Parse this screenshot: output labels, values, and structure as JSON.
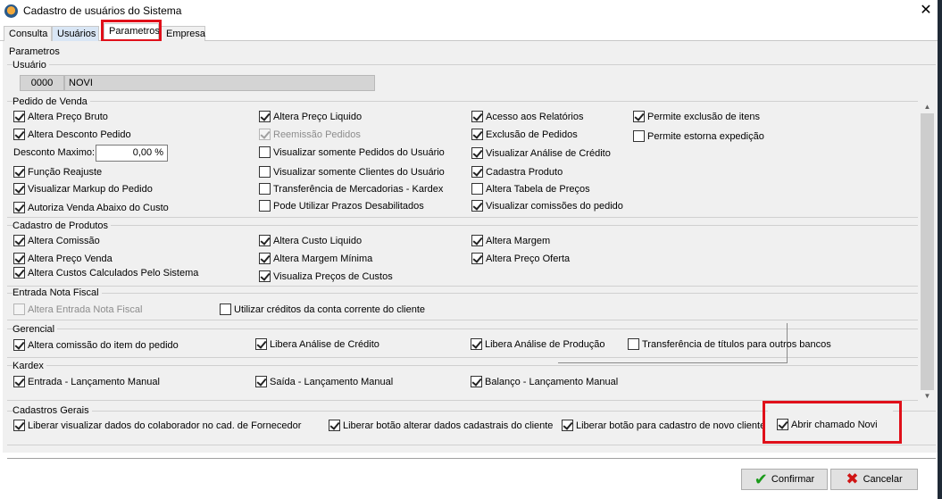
{
  "window": {
    "title": "Cadastro de usuários do Sistema",
    "close_icon": "close-icon"
  },
  "tabs": [
    "Consulta",
    "Usuários",
    "Parametros",
    "Empresa"
  ],
  "panel_title": "Parametros",
  "usuario": {
    "label": "Usuário",
    "code": "0000",
    "name": "NOVI"
  },
  "pedido_venda": {
    "title": "Pedido de Venda",
    "desconto_label": "Desconto Maximo:",
    "desconto_value": "0,00 %",
    "items": [
      {
        "label": "Altera Preço Bruto",
        "checked": true,
        "disabled": false
      },
      {
        "label": "Altera Desconto Pedido",
        "checked": true,
        "disabled": false
      },
      {
        "label": "Função Reajuste",
        "checked": true,
        "disabled": false
      },
      {
        "label": "Visualizar Markup do Pedido",
        "checked": true,
        "disabled": false
      },
      {
        "label": "Autoriza Venda Abaixo do Custo",
        "checked": true,
        "disabled": false
      },
      {
        "label": "Altera Preço Liquido",
        "checked": true,
        "disabled": false
      },
      {
        "label": "Reemissão Pedidos",
        "checked": true,
        "disabled": true
      },
      {
        "label": "Visualizar somente Pedidos do Usuário",
        "checked": false,
        "disabled": false
      },
      {
        "label": "Visualizar somente Clientes do Usuário",
        "checked": false,
        "disabled": false
      },
      {
        "label": "Transferência de Mercadorias - Kardex",
        "checked": false,
        "disabled": false
      },
      {
        "label": "Pode Utilizar Prazos Desabilitados",
        "checked": false,
        "disabled": false
      },
      {
        "label": "Acesso aos Relatórios",
        "checked": true,
        "disabled": false
      },
      {
        "label": "Exclusão de Pedidos",
        "checked": true,
        "disabled": false
      },
      {
        "label": "Visualizar Análise de Crédito",
        "checked": true,
        "disabled": false
      },
      {
        "label": "Cadastra Produto",
        "checked": true,
        "disabled": false
      },
      {
        "label": "Altera Tabela de Preços",
        "checked": false,
        "disabled": false
      },
      {
        "label": "Visualizar comissões do pedido",
        "checked": true,
        "disabled": false
      },
      {
        "label": "Permite exclusão de itens",
        "checked": true,
        "disabled": false
      },
      {
        "label": "Permite estorna expedição",
        "checked": false,
        "disabled": false
      }
    ]
  },
  "cadastro_produtos": {
    "title": "Cadastro de Produtos",
    "items": [
      {
        "label": "Altera Comissão",
        "checked": true,
        "disabled": false
      },
      {
        "label": "Altera Preço Venda",
        "checked": true,
        "disabled": false
      },
      {
        "label": "Altera Custos Calculados Pelo Sistema",
        "checked": true,
        "disabled": false
      },
      {
        "label": "Altera Custo Liquido",
        "checked": true,
        "disabled": false
      },
      {
        "label": "Altera Margem Mínima",
        "checked": true,
        "disabled": false
      },
      {
        "label": "Visualiza Preços de Custos",
        "checked": true,
        "disabled": false
      },
      {
        "label": "Altera Margem",
        "checked": true,
        "disabled": false
      },
      {
        "label": "Altera Preço Oferta",
        "checked": true,
        "disabled": false
      }
    ]
  },
  "entrada_nf": {
    "title": "Entrada Nota Fiscal",
    "items": [
      {
        "label": "Altera Entrada Nota Fiscal",
        "checked": false,
        "disabled": true
      },
      {
        "label": "Utilizar créditos da conta corrente do cliente",
        "checked": false,
        "disabled": false
      }
    ]
  },
  "gerencial": {
    "title": "Gerencial",
    "items": [
      {
        "label": "Altera comissão do item do pedido",
        "checked": true,
        "disabled": false
      },
      {
        "label": "Libera Análise de Crédito",
        "checked": true,
        "disabled": false
      },
      {
        "label": "Libera Análise de Produção",
        "checked": true,
        "disabled": false
      },
      {
        "label": "Transferência de títulos para outros bancos",
        "checked": false,
        "disabled": false
      }
    ]
  },
  "kardex": {
    "title": "Kardex",
    "items": [
      {
        "label": "Entrada - Lançamento Manual",
        "checked": true,
        "disabled": false
      },
      {
        "label": "Saída - Lançamento Manual",
        "checked": true,
        "disabled": false
      },
      {
        "label": "Balanço - Lançamento Manual",
        "checked": true,
        "disabled": false
      }
    ]
  },
  "cadastros_gerais": {
    "title": "Cadastros Gerais",
    "items": [
      {
        "label": "Liberar visualizar dados do colaborador no cad. de Fornecedor",
        "checked": true,
        "disabled": false
      },
      {
        "label": "Liberar botão alterar dados cadastrais do cliente",
        "checked": true,
        "disabled": false
      },
      {
        "label": "Liberar botão para cadastro de novo cliente",
        "checked": true,
        "disabled": false
      },
      {
        "label": "Abrir chamado Novi",
        "checked": true,
        "disabled": false
      }
    ]
  },
  "buttons": {
    "confirm": "Confirmar",
    "cancel": "Cancelar"
  },
  "colors": {
    "highlight": "#e0101a",
    "confirm_icon": "#1a9a1a",
    "cancel_icon": "#d01414"
  }
}
